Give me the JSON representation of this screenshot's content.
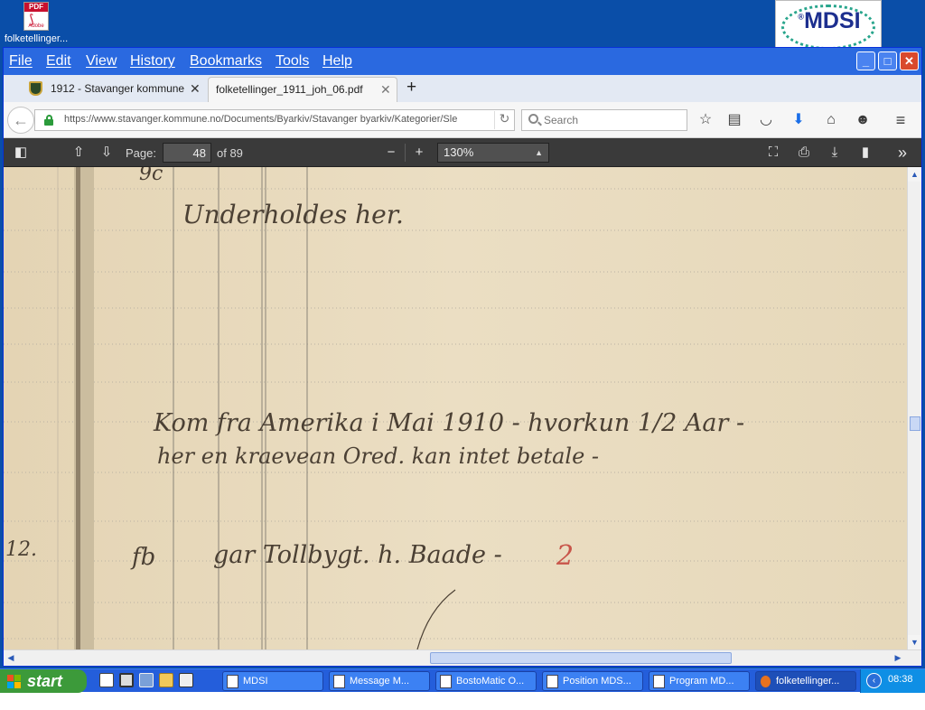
{
  "desktop": {
    "icon": {
      "label": "folketellinger...",
      "badge": "PDF",
      "brand": "Adobe"
    },
    "logo": {
      "text": "MDSI",
      "registered": "®"
    }
  },
  "menubar": {
    "items": [
      {
        "label": "File"
      },
      {
        "label": "Edit"
      },
      {
        "label": "View"
      },
      {
        "label": "History"
      },
      {
        "label": "Bookmarks"
      },
      {
        "label": "Tools"
      },
      {
        "label": "Help"
      }
    ]
  },
  "tabs": [
    {
      "label": "1912 - Stavanger kommune",
      "active": false
    },
    {
      "label": "folketellinger_1911_joh_06.pdf",
      "active": true
    }
  ],
  "navbar": {
    "url": "https://www.stavanger.kommune.no/Documents/Byarkiv/Stavanger byarkiv/Kategorier/Sle",
    "search_placeholder": "Search"
  },
  "pdf_toolbar": {
    "page_label": "Page:",
    "page_current": "48",
    "page_total": "of 89",
    "zoom": "130%"
  },
  "document": {
    "handwriting": [
      "Underholdes her.",
      "Kom fra Amerika i Mai 1910 - hvorkun 1/2 Aar -",
      "her en kraevean Ored. kan intet betale -",
      "fb",
      "gar Tollbygt. h. Baade -",
      "2",
      "9c",
      "12."
    ]
  },
  "taskbar": {
    "start_label": "start",
    "tasks": [
      {
        "label": "MDSI"
      },
      {
        "label": "Message M..."
      },
      {
        "label": "BostoMatic O..."
      },
      {
        "label": "Position MDS..."
      },
      {
        "label": "Program MD..."
      },
      {
        "label": "folketellinger..."
      }
    ],
    "clock": "08:38"
  },
  "colors": {
    "desktop": "#0a4ea8",
    "menubar": "#2a69e0",
    "pdf_toolbar": "#3a3a3a",
    "paper": "#e9dcc0",
    "taskbar": "#245edb",
    "start": "#3c9a3a"
  }
}
